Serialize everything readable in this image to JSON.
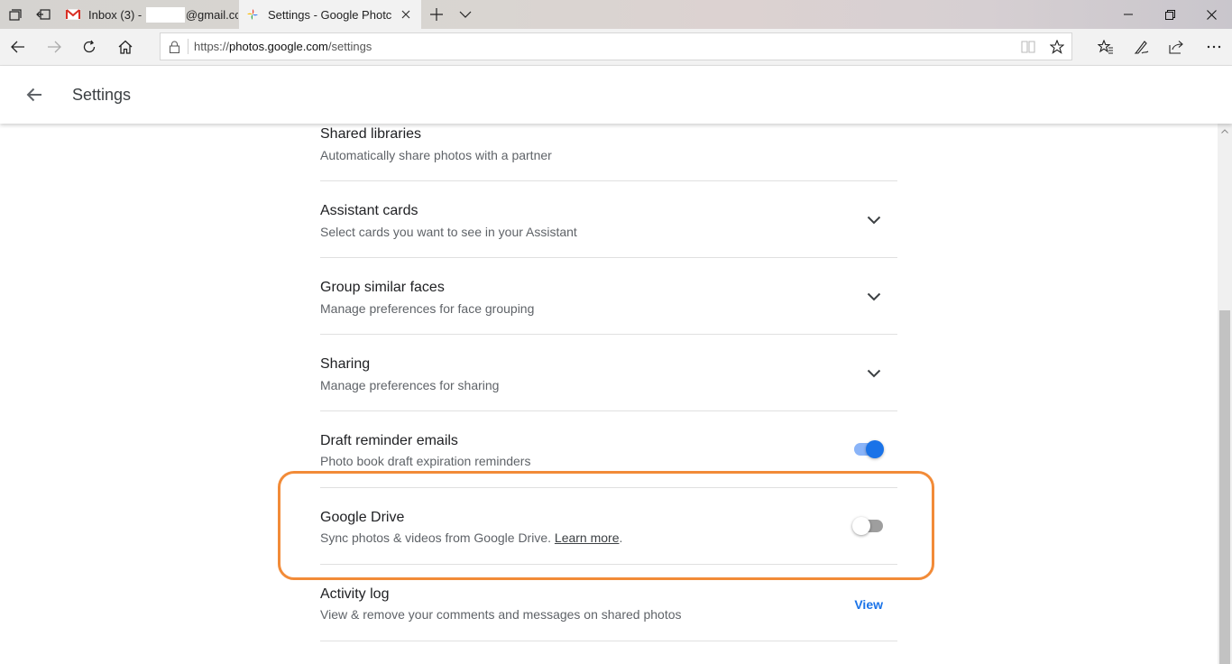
{
  "browser": {
    "tabs": [
      {
        "title_prefix": "Inbox (3) - ",
        "title_suffix": "@gmail.cc",
        "active": false,
        "favicon": "gmail-icon"
      },
      {
        "title": "Settings - Google Photc",
        "active": true,
        "favicon": "google-photos-icon"
      }
    ],
    "address_bar": {
      "url_scheme": "https://",
      "url_host": "photos.google.com",
      "url_path": "/settings"
    },
    "icons": [
      "tab-list-icon",
      "set-aside-tabs-icon",
      "new-tab-icon",
      "tab-dropdown-icon",
      "minimize-icon",
      "restore-icon",
      "close-icon",
      "back-icon",
      "forward-icon",
      "refresh-icon",
      "home-icon",
      "lock-icon",
      "reading-view-icon",
      "favorite-star-icon",
      "favorites-hub-icon",
      "pen-icon",
      "share-icon",
      "more-icon"
    ]
  },
  "header": {
    "title": "Settings"
  },
  "settings": [
    {
      "label": "Shared libraries",
      "description": "Automatically share photos with a partner",
      "control": "none"
    },
    {
      "label": "Assistant cards",
      "description": "Select cards you want to see in your Assistant",
      "control": "chevron"
    },
    {
      "label": "Group similar faces",
      "description": "Manage preferences for face grouping",
      "control": "chevron"
    },
    {
      "label": "Sharing",
      "description": "Manage preferences for sharing",
      "control": "chevron"
    },
    {
      "label": "Draft reminder emails",
      "description": "Photo book draft expiration reminders",
      "control": "toggle",
      "toggle_on": true
    },
    {
      "label": "Google Drive",
      "description": "Sync photos & videos from Google Drive.",
      "link_text": "Learn more",
      "description_end": ".",
      "control": "toggle",
      "toggle_on": false
    },
    {
      "label": "Activity log",
      "description": "View & remove your comments and messages on shared photos",
      "control": "link",
      "link_label": "View"
    }
  ],
  "colors": {
    "toggle_on_track": "#8ab4f8",
    "toggle_on_knob": "#1a73e8",
    "toggle_off_track": "#9e9e9e",
    "toggle_off_knob": "#ffffff",
    "highlight": "#f28b38",
    "link": "#1a73e8"
  }
}
